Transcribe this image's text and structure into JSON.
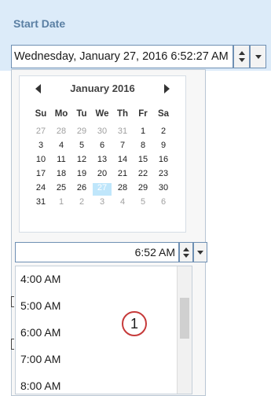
{
  "field": {
    "label": "Start Date",
    "value": "Wednesday, January 27, 2016 6:52:27 AM"
  },
  "calendar": {
    "month_label": "January 2016",
    "weekdays": [
      "Su",
      "Mo",
      "Tu",
      "We",
      "Th",
      "Fr",
      "Sa"
    ],
    "weeks": [
      [
        {
          "d": "27",
          "cur": false
        },
        {
          "d": "28",
          "cur": false
        },
        {
          "d": "29",
          "cur": false
        },
        {
          "d": "30",
          "cur": false
        },
        {
          "d": "31",
          "cur": false
        },
        {
          "d": "1",
          "cur": true
        },
        {
          "d": "2",
          "cur": true
        }
      ],
      [
        {
          "d": "3",
          "cur": true
        },
        {
          "d": "4",
          "cur": true
        },
        {
          "d": "5",
          "cur": true
        },
        {
          "d": "6",
          "cur": true
        },
        {
          "d": "7",
          "cur": true
        },
        {
          "d": "8",
          "cur": true
        },
        {
          "d": "9",
          "cur": true
        }
      ],
      [
        {
          "d": "10",
          "cur": true
        },
        {
          "d": "11",
          "cur": true
        },
        {
          "d": "12",
          "cur": true
        },
        {
          "d": "13",
          "cur": true
        },
        {
          "d": "14",
          "cur": true
        },
        {
          "d": "15",
          "cur": true
        },
        {
          "d": "16",
          "cur": true
        }
      ],
      [
        {
          "d": "17",
          "cur": true
        },
        {
          "d": "18",
          "cur": true
        },
        {
          "d": "19",
          "cur": true
        },
        {
          "d": "20",
          "cur": true
        },
        {
          "d": "21",
          "cur": true
        },
        {
          "d": "22",
          "cur": true
        },
        {
          "d": "23",
          "cur": true
        }
      ],
      [
        {
          "d": "24",
          "cur": true
        },
        {
          "d": "25",
          "cur": true
        },
        {
          "d": "26",
          "cur": true
        },
        {
          "d": "27",
          "cur": true,
          "sel": true
        },
        {
          "d": "28",
          "cur": true
        },
        {
          "d": "29",
          "cur": true
        },
        {
          "d": "30",
          "cur": true
        }
      ],
      [
        {
          "d": "31",
          "cur": true
        },
        {
          "d": "1",
          "cur": false
        },
        {
          "d": "2",
          "cur": false
        },
        {
          "d": "3",
          "cur": false
        },
        {
          "d": "4",
          "cur": false
        },
        {
          "d": "5",
          "cur": false
        },
        {
          "d": "6",
          "cur": false
        }
      ]
    ]
  },
  "time_picker": {
    "value": "6:52 AM",
    "options": [
      "4:00 AM",
      "5:00 AM",
      "6:00 AM",
      "7:00 AM",
      "8:00 AM"
    ]
  },
  "callout": {
    "label": "1"
  },
  "colors": {
    "header_band": "#dcebf9",
    "label_text": "#5a7fa3",
    "selected_day": "#bfe6fb",
    "callout_ring": "#c63a3a"
  },
  "icons": [
    "spin-up-icon",
    "spin-down-icon",
    "dropdown-arrow-icon",
    "prev-month-icon",
    "next-month-icon"
  ]
}
